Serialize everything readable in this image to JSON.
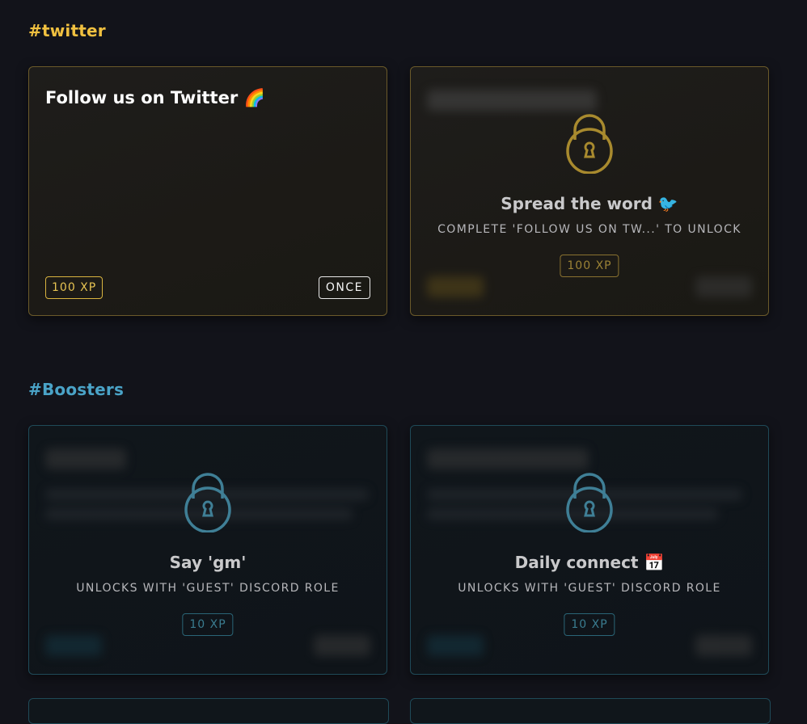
{
  "sections": {
    "twitter": {
      "title": "#twitter"
    },
    "boosters": {
      "title": "#Boosters"
    }
  },
  "cards": {
    "follow": {
      "title": "Follow us on Twitter 🌈",
      "xp": "100 XP",
      "frequency": "ONCE"
    },
    "spread": {
      "title": "Spread the word 🐦",
      "lock_message": "COMPLETE 'FOLLOW US ON TW...' TO UNLOCK",
      "xp": "100 XP"
    },
    "gm": {
      "title": "Say 'gm'",
      "lock_message": "UNLOCKS WITH 'GUEST' DISCORD ROLE",
      "xp": "10 XP"
    },
    "daily": {
      "title": "Daily connect 📅",
      "lock_message": "UNLOCKS WITH 'GUEST' DISCORD ROLE",
      "xp": "10 XP"
    }
  },
  "colors": {
    "background": "#12131a",
    "twitter_accent": "#f0c040",
    "boosters_accent": "#4aa3c7"
  },
  "icons": {
    "lock": "padlock-icon"
  }
}
